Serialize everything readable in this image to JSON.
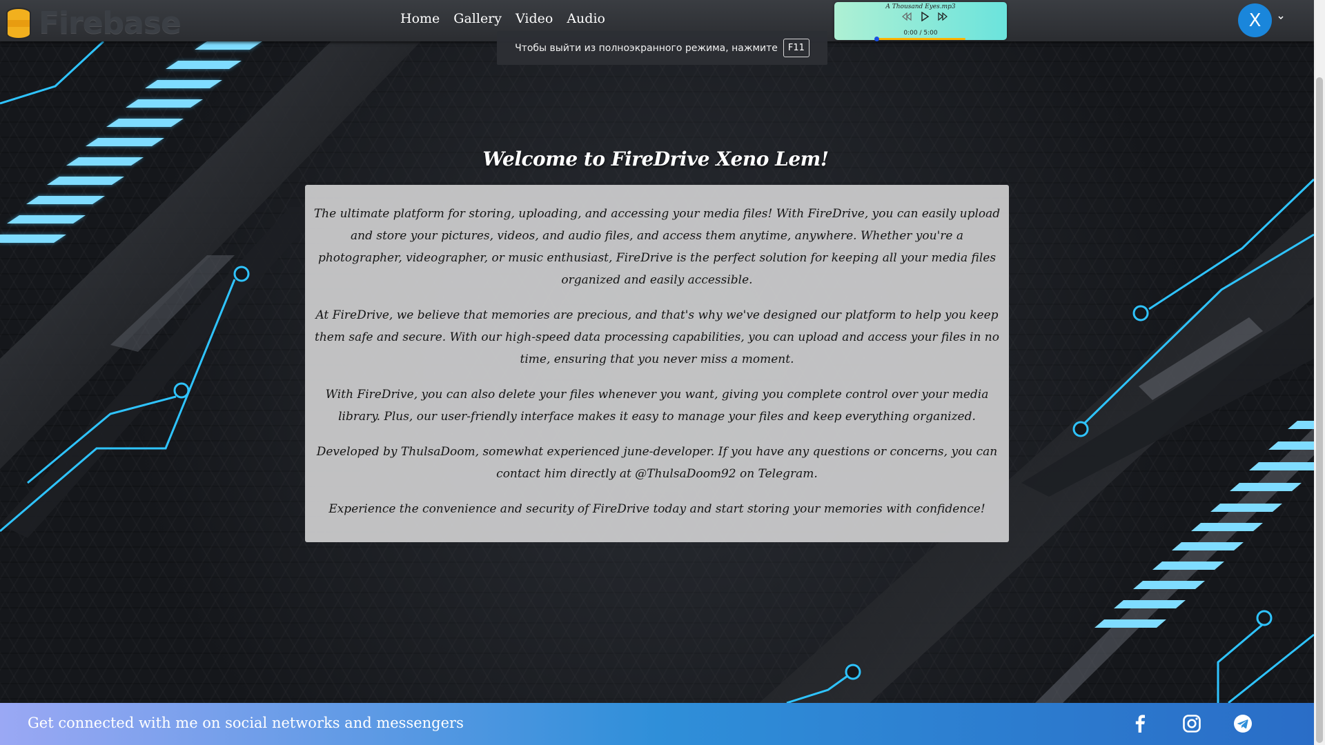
{
  "brand": {
    "name": "Firebase",
    "logo_icon": "database-icon"
  },
  "nav": {
    "items": [
      "Home",
      "Gallery",
      "Video",
      "Audio"
    ]
  },
  "fullscreen_notice": {
    "text": "Чтобы выйти из полноэкранного режима, нажмите",
    "key": "F11"
  },
  "player": {
    "title": "A Thousand Eyes.mp3",
    "time": "0:00 / 5:00",
    "progress": 0.0,
    "icons": [
      "rewind-icon",
      "play-icon",
      "fast-forward-icon"
    ]
  },
  "user": {
    "avatar_letter": "X"
  },
  "main": {
    "heading": "Welcome to FireDrive Xeno Lem!",
    "paragraphs": [
      "The ultimate platform for storing, uploading, and accessing your media files! With FireDrive, you can easily upload and store your pictures, videos, and audio files, and access them anytime, anywhere. Whether you're a photographer, videographer, or music enthusiast, FireDrive is the perfect solution for keeping all your media files organized and easily accessible.",
      "At FireDrive, we believe that memories are precious, and that's why we've designed our platform to help you keep them safe and secure. With our high-speed data processing capabilities, you can upload and access your files in no time, ensuring that you never miss a moment.",
      "With FireDrive, you can also delete your files whenever you want, giving you complete control over your media library. Plus, our user-friendly interface makes it easy to manage your files and keep everything organized.",
      "Developed by ThulsaDoom, somewhat experienced june-developer. If you have any questions or concerns, you can contact him directly at @ThulsaDoom92 on Telegram.",
      "Experience the convenience and security of FireDrive today and start storing your memories with confidence!"
    ]
  },
  "footer": {
    "text": "Get connected with me on social networks and messengers",
    "social_icons": [
      "facebook-icon",
      "instagram-icon",
      "telegram-icon"
    ]
  },
  "colors": {
    "accent_cyan": "#2fc4ff",
    "header_bg": "#2f3135",
    "avatar_bg": "#1a86db",
    "footer_gradient": [
      "#9aa8f4",
      "#2f8fd9",
      "#2a6dc7"
    ]
  }
}
